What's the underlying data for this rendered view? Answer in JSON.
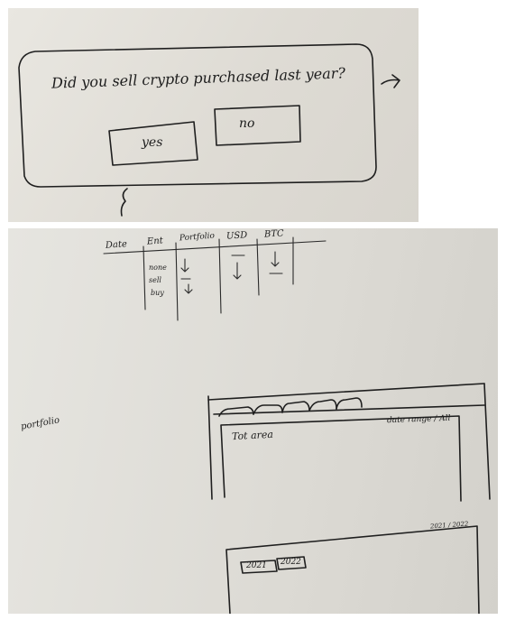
{
  "dialog": {
    "question": "Did you sell crypto purchased last year?",
    "yes_label": "yes",
    "no_label": "no",
    "next_arrow": "→",
    "brace": "{"
  },
  "table": {
    "headers": [
      "Date",
      "Ent",
      "Portfolio",
      "USD",
      "BTC"
    ],
    "ent_rows": [
      "none",
      "sell",
      "buy"
    ],
    "portfolio_marks": [
      "↓",
      "—",
      "↓"
    ],
    "usd_marks": [
      "—",
      "↓"
    ],
    "btc_marks": [
      "↓",
      "—"
    ]
  },
  "portfolio": {
    "side_label": "portfolio",
    "tab_count": 5,
    "area_title": "Tot area",
    "filter_label": "date range / All"
  },
  "year_panel": {
    "range_label": "2021 / 2022",
    "years": [
      "2021",
      "2022"
    ]
  }
}
